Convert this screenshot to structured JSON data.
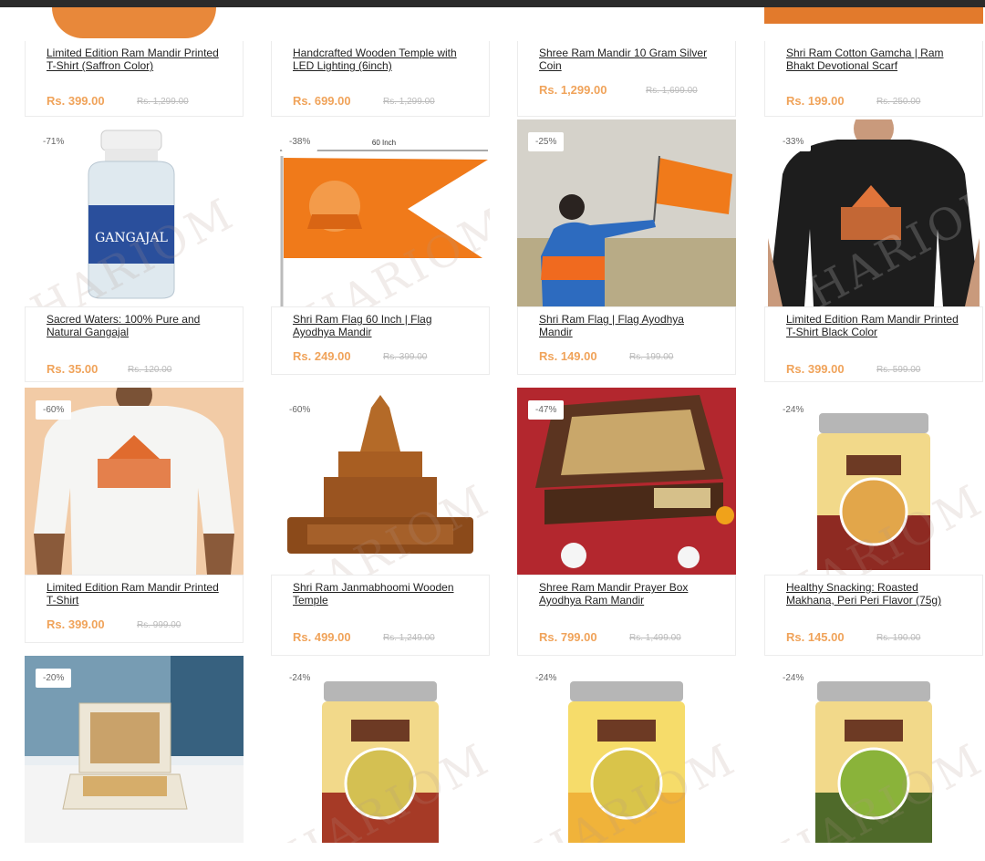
{
  "watermark": "HARIOM ORGANIC",
  "rows": [
    {
      "cards": [
        {
          "title": "Limited Edition Ram Mandir Printed T-Shirt (Saffron Color)",
          "price": "Rs. 399.00",
          "old_price": "Rs. 1,299.00"
        },
        {
          "title": "Handcrafted Wooden Temple with LED Lighting (6inch)",
          "price": "Rs. 699.00",
          "old_price": "Rs. 1,299.00"
        },
        {
          "title": "Shree Ram Mandir 10 Gram Silver Coin",
          "price": "Rs. 1,299.00",
          "old_price": "Rs. 1,699.00"
        },
        {
          "title": "Shri Ram Cotton Gamcha | Ram Bhakt Devotional Scarf",
          "price": "Rs. 199.00",
          "old_price": "Rs. 250.00"
        }
      ]
    },
    {
      "cards": [
        {
          "badge": "-71%",
          "title": "Sacred Waters: 100% Pure and Natural Gangajal",
          "price": "Rs. 35.00",
          "old_price": "Rs. 120.00",
          "image": "gangajal-bottle",
          "label": "GANGAJAL"
        },
        {
          "badge": "-38%",
          "title": "Shri Ram Flag 60 Inch | Flag Ayodhya Mandir",
          "price": "Rs. 249.00",
          "old_price": "Rs. 399.00",
          "image": "ram-flag",
          "label": "60 Inch"
        },
        {
          "badge": "-25%",
          "title": "Shri Ram Flag | Flag Ayodhya Mandir",
          "price": "Rs. 149.00",
          "old_price": "Rs. 199.00",
          "image": "man-with-flag"
        },
        {
          "badge": "-33%",
          "title": "Limited Edition Ram Mandir Printed T-Shirt Black Color",
          "price": "Rs. 399.00",
          "old_price": "Rs. 599.00",
          "image": "black-tshirt"
        }
      ]
    },
    {
      "cards": [
        {
          "badge": "-60%",
          "title": "Limited Edition Ram Mandir Printed T-Shirt",
          "price": "Rs. 399.00",
          "old_price": "Rs. 999.00",
          "image": "white-tshirt"
        },
        {
          "badge": "-60%",
          "title": "Shri Ram Janmabhoomi Wooden Temple",
          "price": "Rs. 499.00",
          "old_price": "Rs. 1,249.00",
          "image": "wooden-temple"
        },
        {
          "badge": "-47%",
          "title": "Shree Ram Mandir Prayer Box Ayodhya Ram Mandir",
          "price": "Rs. 799.00",
          "old_price": "Rs. 1,499.00",
          "image": "prayer-box"
        },
        {
          "badge": "-24%",
          "title": "Healthy Snacking: Roasted Makhana, Peri Peri Flavor (75g)",
          "price": "Rs. 145.00",
          "old_price": "Rs. 190.00",
          "image": "makhana-jar-red"
        }
      ]
    },
    {
      "cards": [
        {
          "badge": "-20%",
          "image": "white-box"
        },
        {
          "badge": "-24%",
          "image": "makhana-jar-red"
        },
        {
          "badge": "-24%",
          "image": "makhana-jar-yellow"
        },
        {
          "badge": "-24%",
          "image": "makhana-jar-green"
        }
      ]
    }
  ],
  "colors": {
    "price": "#f0a35a",
    "saffron": "#f07a1a",
    "badge_text": "#666666"
  }
}
